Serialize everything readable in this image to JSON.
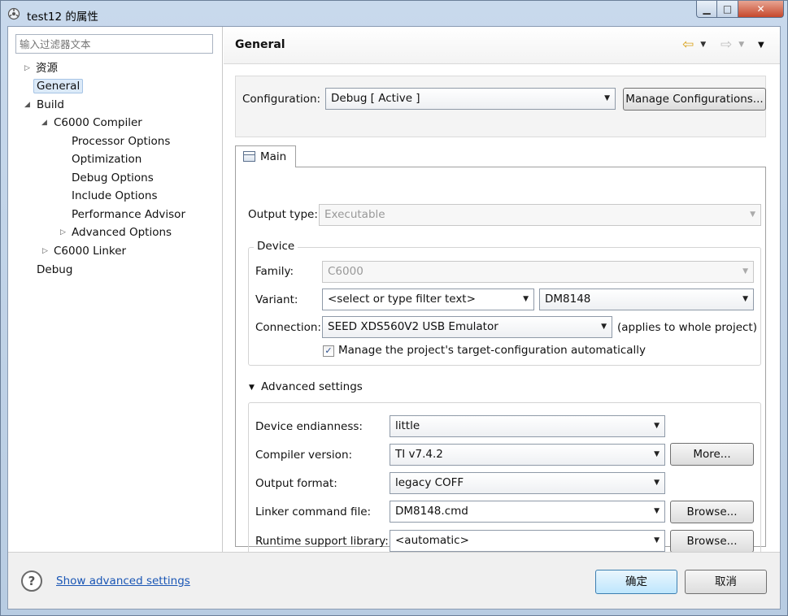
{
  "window": {
    "title": "test12 的属性",
    "minimize_symbol": "▁",
    "maximize_symbol": "□",
    "close_symbol": "✕"
  },
  "left_pane": {
    "filter_placeholder": "输入过滤器文本",
    "items": [
      {
        "label": "资源",
        "arrow": "▷"
      },
      {
        "label": "General",
        "arrow": ""
      },
      {
        "label": "Build",
        "arrow": "◢"
      },
      {
        "label": "C6000 Compiler",
        "arrow": "◢"
      },
      {
        "label": "Processor Options",
        "arrow": ""
      },
      {
        "label": "Optimization",
        "arrow": ""
      },
      {
        "label": "Debug Options",
        "arrow": ""
      },
      {
        "label": "Include Options",
        "arrow": ""
      },
      {
        "label": "Performance Advisor",
        "arrow": ""
      },
      {
        "label": "Advanced Options",
        "arrow": "▷"
      },
      {
        "label": "C6000 Linker",
        "arrow": "▷"
      },
      {
        "label": "Debug",
        "arrow": ""
      }
    ]
  },
  "header": {
    "title": "General",
    "back_arrow": "⇦",
    "forward_arrow": "⇨",
    "dropdown": "▼"
  },
  "configuration": {
    "label": "Configuration:",
    "value": "Debug  [ Active ]",
    "manage_button": "Manage Configurations..."
  },
  "tab": {
    "label": "Main"
  },
  "main": {
    "output_type_label": "Output type:",
    "output_type_value": "Executable",
    "device_group_title": "Device",
    "family_label": "Family:",
    "family_value": "C6000",
    "variant_label": "Variant:",
    "variant_filter": "<select or type filter text>",
    "variant_value": "DM8148",
    "connection_label": "Connection:",
    "connection_value": "SEED XDS560V2 USB Emulator",
    "connection_note": "(applies to whole project)",
    "manage_target_checkbox": "Manage the project's target-configuration automatically",
    "manage_target_checked": "✓",
    "advanced_toggle": "▼",
    "advanced_title": "Advanced settings",
    "endianness_label": "Device endianness:",
    "endianness_value": "little",
    "compiler_label": "Compiler version:",
    "compiler_value": "TI v7.4.2",
    "more_button": "More...",
    "output_format_label": "Output format:",
    "output_format_value": "legacy COFF",
    "linker_label": "Linker command file:",
    "linker_value": "DM8148.cmd",
    "browse_button_1": "Browse...",
    "runtime_label": "Runtime support library:",
    "runtime_value": "<automatic>",
    "browse_button_2": "Browse..."
  },
  "footer": {
    "help_symbol": "?",
    "advanced_link": "Show advanced settings",
    "ok_button": "确定",
    "cancel_button": "取消"
  },
  "colors": {
    "link": "#1a56b5",
    "selection": "#dceaf8",
    "close_button": "#c6482c"
  }
}
